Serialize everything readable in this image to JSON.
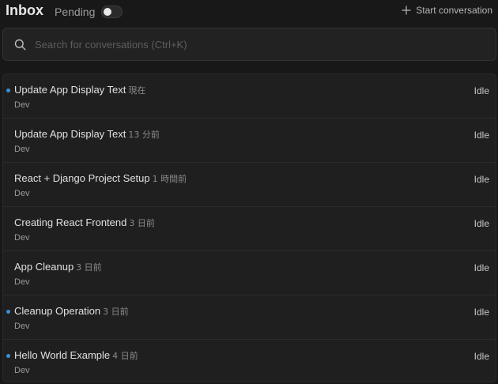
{
  "header": {
    "title": "Inbox",
    "pending_label": "Pending",
    "pending_enabled": false,
    "start_label": "Start conversation"
  },
  "search": {
    "placeholder": "Search for conversations (Ctrl+K)",
    "value": ""
  },
  "colors": {
    "unread_dot": "#3b8fd9",
    "background": "#181818"
  },
  "conversations": [
    {
      "title": "Update App Display Text",
      "time": "現在",
      "workspace": "Dev",
      "status": "Idle",
      "unread": true
    },
    {
      "title": "Update App Display Text",
      "time": "13 分前",
      "workspace": "Dev",
      "status": "Idle",
      "unread": false
    },
    {
      "title": "React + Django Project Setup",
      "time": "1 時間前",
      "workspace": "Dev",
      "status": "Idle",
      "unread": false
    },
    {
      "title": "Creating React Frontend",
      "time": "3 日前",
      "workspace": "Dev",
      "status": "Idle",
      "unread": false
    },
    {
      "title": "App Cleanup",
      "time": "3 日前",
      "workspace": "Dev",
      "status": "Idle",
      "unread": false
    },
    {
      "title": "Cleanup Operation",
      "time": "3 日前",
      "workspace": "Dev",
      "status": "Idle",
      "unread": true
    },
    {
      "title": "Hello World Example",
      "time": "4 日前",
      "workspace": "Dev",
      "status": "Idle",
      "unread": true
    }
  ]
}
